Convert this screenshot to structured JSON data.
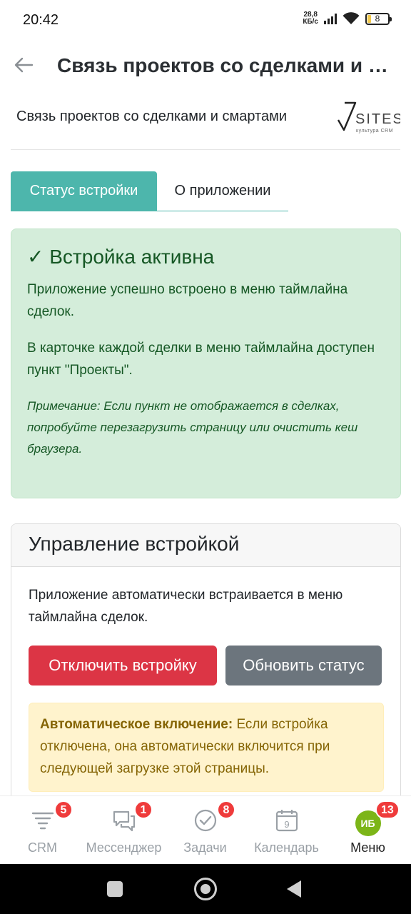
{
  "status_bar": {
    "time": "20:42",
    "speed_value": "28,8",
    "speed_unit": "КБ/с",
    "battery": "8"
  },
  "header": {
    "title": "Связь проектов со сделками и смартами",
    "back_icon": "arrow-left-icon"
  },
  "app": {
    "subtitle": "Связь проектов со сделками и смартами",
    "logo_text": "SITES",
    "logo_tagline": "культура CRM"
  },
  "tabs": [
    {
      "label": "Статус встройки",
      "active": true
    },
    {
      "label": "О приложении",
      "active": false
    }
  ],
  "success_alert": {
    "title": "✓ Встройка активна",
    "p1": "Приложение успешно встроено в меню таймлайна сделок.",
    "p2": "В карточке каждой сделки в меню таймлайна доступен пункт \"Проекты\".",
    "note": "Примечание: Если пункт не отображается в сделках, попробуйте перезагрузить страницу или очистить кеш браузера."
  },
  "management": {
    "title": "Управление встройкой",
    "text": "Приложение автоматически встраивается в меню таймлайна сделок.",
    "disable_button": "Отключить встройку",
    "refresh_button": "Обновить статус",
    "warning_bold": "Автоматическое включение:",
    "warning_text": " Если встройка отключена, она автоматически включится при следующей загрузке этой страницы."
  },
  "bottom_nav": [
    {
      "label": "CRM",
      "badge": "5",
      "icon": "crm-funnel-icon"
    },
    {
      "label": "Мессенджер",
      "badge": "1",
      "icon": "chat-icon"
    },
    {
      "label": "Задачи",
      "badge": "8",
      "icon": "check-circle-icon"
    },
    {
      "label": "Календарь",
      "badge": "",
      "icon": "calendar-icon",
      "calendar_day": "9"
    },
    {
      "label": "Меню",
      "badge": "13",
      "icon": "avatar",
      "avatar_initials": "ИБ"
    }
  ],
  "colors": {
    "accent": "#4db6ac",
    "success_bg": "#d4edda",
    "success_text": "#155724",
    "danger": "#dc3545",
    "secondary": "#6c757d",
    "warning_bg": "#fff3cd",
    "warning_text": "#856404",
    "badge": "#ef3b3b"
  }
}
